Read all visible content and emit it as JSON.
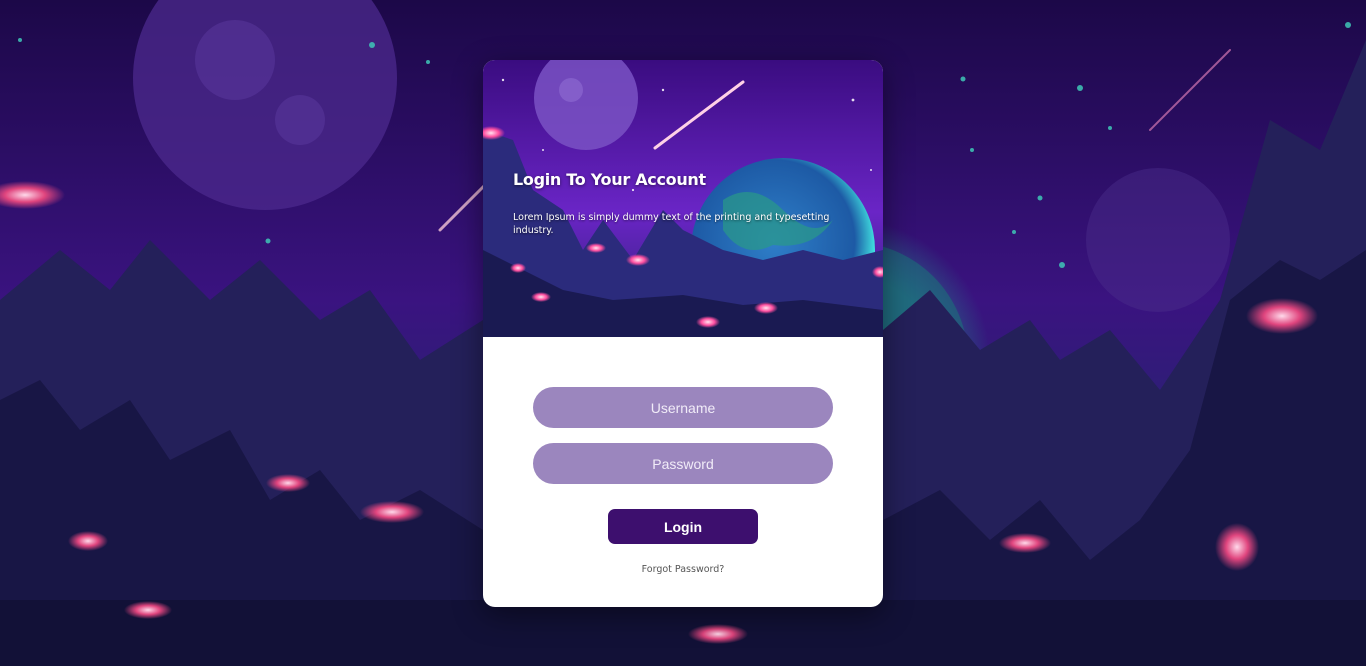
{
  "login_card": {
    "title": "Login To Your Account",
    "subtitle": "Lorem Ipsum is simply dummy text of the printing and typesetting industry.",
    "username_placeholder": "Username",
    "password_placeholder": "Password",
    "login_label": "Login",
    "forgot_label": "Forgot Password?"
  },
  "colors": {
    "field_background": "#9b86be",
    "button_background": "#3d0f6e",
    "card_background": "#ffffff",
    "scene_sky": "#2a0a5e"
  },
  "icons": [
    "planet-icon",
    "earth-icon",
    "comet-icon"
  ]
}
